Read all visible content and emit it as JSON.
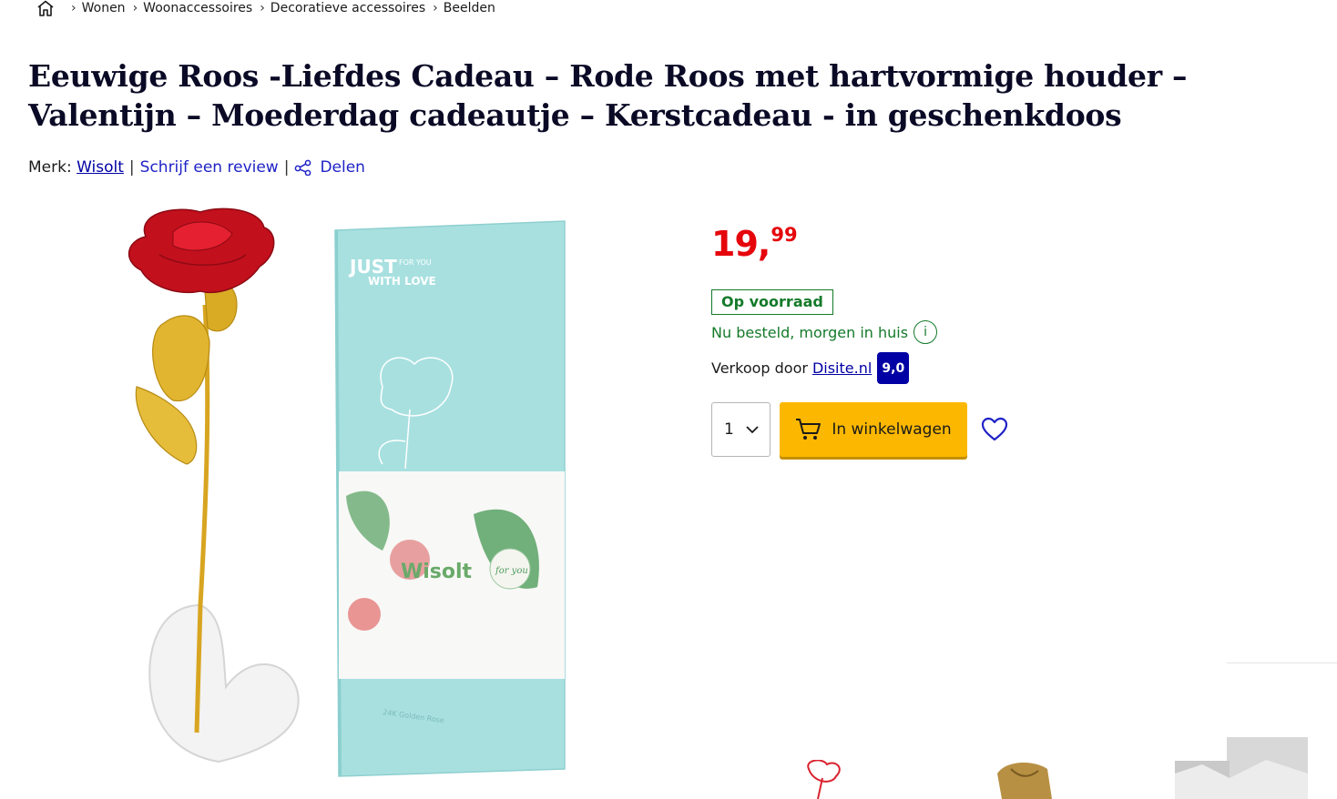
{
  "breadcrumb": {
    "home_icon": "home-icon",
    "items": [
      "Wonen",
      "Woonaccessoires",
      "Decoratieve accessoires",
      "Beelden"
    ]
  },
  "product": {
    "title": "Eeuwige Roos -Liefdes Cadeau – Rode Roos met hartvormige houder – Valentijn – Moederdag cadeautje – Kerstcadeau - in geschenkdoos"
  },
  "meta": {
    "brand_label": "Merk:",
    "brand_name": "Wisolt",
    "review_link": "Schrijf een review",
    "share_link": "Delen"
  },
  "gallery": {
    "box_text_1": "JUST",
    "box_text_2": "FOR YOU",
    "box_text_3": "WITH LOVE",
    "box_brand": "Wisolt",
    "box_badge": "for you",
    "box_bottom": "24K Golden Rose"
  },
  "buy": {
    "price_main": "19,",
    "price_cents": "99",
    "stock_badge": "Op voorraad",
    "delivery": "Nu besteld, morgen in huis",
    "seller_label": "Verkoop door",
    "seller_name": "Disite.nl",
    "seller_score": "9,0",
    "quantity": "1",
    "cart_button": "In winkelwagen"
  },
  "colors": {
    "price": "#e5060c",
    "stock": "#147a2a",
    "link": "#0000a4",
    "cart_button": "#fcb800",
    "title": "#0a0a26"
  }
}
